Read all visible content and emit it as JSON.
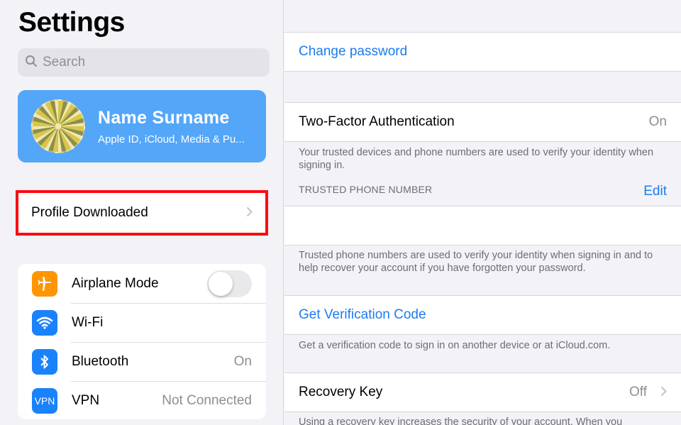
{
  "left": {
    "title": "Settings",
    "search": {
      "placeholder": "Search",
      "icon": "search-icon"
    },
    "profile": {
      "name": "Name Surname",
      "subtitle": "Apple ID, iCloud, Media & Pu...",
      "card_color": "#54a6f8"
    },
    "profile_downloaded": {
      "label": "Profile Downloaded",
      "highlight_color": "#ff0a12"
    },
    "settings_group": [
      {
        "label": "Airplane Mode",
        "icon": "airplane-icon",
        "icon_color": "#ff9500",
        "toggle_on": false
      },
      {
        "label": "Wi-Fi",
        "icon": "wifi-icon",
        "icon_color": "#1a82fb",
        "value": ""
      },
      {
        "label": "Bluetooth",
        "icon": "bluetooth-icon",
        "icon_color": "#1a82fb",
        "value": "On"
      },
      {
        "label": "VPN",
        "icon": "vpn-icon",
        "icon_text": "VPN",
        "icon_color": "#1a82fb",
        "value": "Not Connected"
      }
    ]
  },
  "right": {
    "change_password": "Change password",
    "two_factor": {
      "label": "Two-Factor Authentication",
      "value": "On"
    },
    "two_factor_note": "Your trusted devices and phone numbers are used to verify your identity when signing in.",
    "trusted_phone_header": "TRUSTED PHONE NUMBER",
    "trusted_phone_edit": "Edit",
    "trusted_phone_note": "Trusted phone numbers are used to verify your identity when signing in and to help recover your account if you have forgotten your password.",
    "get_code": "Get Verification Code",
    "get_code_note": "Get a verification code to sign in on another device or at iCloud.com.",
    "recovery_key": {
      "label": "Recovery Key",
      "value": "Off"
    },
    "recovery_note": "Using a recovery key increases the security of your account. When you"
  },
  "colors": {
    "link": "#1a7cf0",
    "background": "#f2f2f7"
  }
}
